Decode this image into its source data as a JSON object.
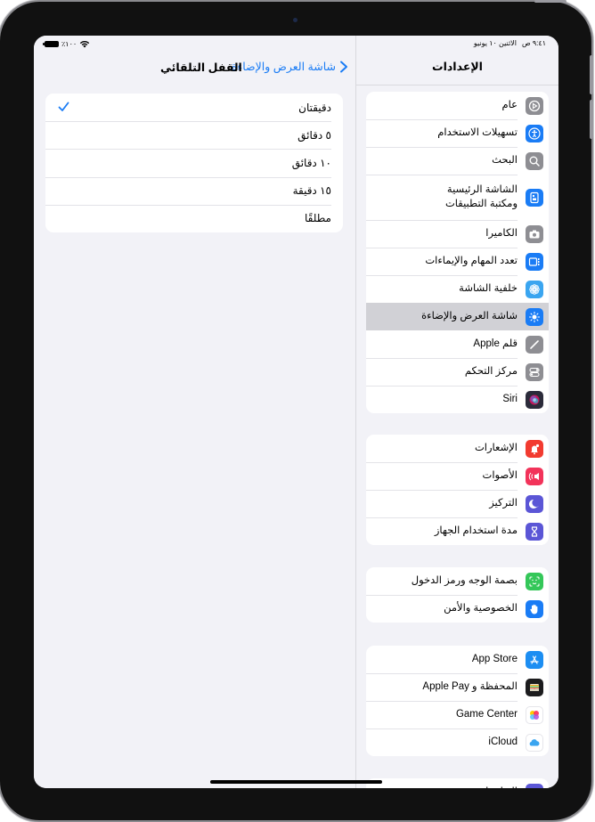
{
  "status_bar": {
    "time": "٩:٤١ ص",
    "date": "الاثنين ١٠ يونيو",
    "battery": "٪١٠٠"
  },
  "sidebar": {
    "title": "الإعدادات",
    "groups": [
      {
        "items": [
          {
            "label": "عام",
            "icon": "gear-icon",
            "color": "#8e8e93"
          },
          {
            "label": "تسهيلات الاستخدام",
            "icon": "accessibility-icon",
            "color": "#1a7cf5"
          },
          {
            "label": "البحث",
            "icon": "search-icon",
            "color": "#8e8e93"
          },
          {
            "label": "الشاشة الرئيسية ومكتبة التطبيقات",
            "line1": "الشاشة الرئيسية",
            "line2": "ومكتبة التطبيقات",
            "icon": "home-screen-icon",
            "color": "#1a7cf5"
          },
          {
            "label": "الكاميرا",
            "icon": "camera-icon",
            "color": "#8e8e93"
          },
          {
            "label": "تعدد المهام والإيماءات",
            "icon": "multitasking-icon",
            "color": "#1a7cf5"
          },
          {
            "label": "خلفية الشاشة",
            "icon": "wallpaper-icon",
            "color": "#3aa5f0"
          },
          {
            "label": "شاشة العرض والإضاءة",
            "icon": "brightness-icon",
            "color": "#1a7cf5",
            "selected": true
          },
          {
            "label": "قلم Apple",
            "icon": "pencil-icon",
            "color": "#8e8e93"
          },
          {
            "label": "مركز التحكم",
            "icon": "control-center-icon",
            "color": "#8e8e93"
          },
          {
            "label": "Siri",
            "icon": "siri-icon",
            "color": "#2b2b3a"
          }
        ]
      },
      {
        "items": [
          {
            "label": "الإشعارات",
            "icon": "notifications-icon",
            "color": "#f23b30"
          },
          {
            "label": "الأصوات",
            "icon": "sounds-icon",
            "color": "#f2335a"
          },
          {
            "label": "التركيز",
            "icon": "focus-moon-icon",
            "color": "#5b56d6"
          },
          {
            "label": "مدة استخدام الجهاز",
            "icon": "screen-time-icon",
            "color": "#5b56d6"
          }
        ]
      },
      {
        "items": [
          {
            "label": "بصمة الوجه ورمز الدخول",
            "icon": "face-id-icon",
            "color": "#34c759"
          },
          {
            "label": "الخصوصية والأمن",
            "icon": "privacy-hand-icon",
            "color": "#1a7cf5"
          }
        ]
      },
      {
        "items": [
          {
            "label": "App Store",
            "icon": "app-store-icon",
            "color": "#1c8ef2"
          },
          {
            "label": "المحفظة و Apple Pay",
            "icon": "wallet-icon",
            "color": "#1c1c1e"
          },
          {
            "label": "Game Center",
            "icon": "game-center-icon",
            "color": "#ffffff"
          },
          {
            "label": "iCloud",
            "icon": "icloud-icon",
            "color": "#ffffff"
          }
        ]
      },
      {
        "items": [
          {
            "label": "التطبيقات",
            "icon": "apps-icon",
            "color": "#5b56d6"
          }
        ]
      }
    ]
  },
  "detail": {
    "back_label": "شاشة العرض والإضاءة",
    "title": "القفل التلقائي",
    "options": [
      {
        "label": "دقيقتان",
        "checked": true
      },
      {
        "label": "٥ دقائق",
        "checked": false
      },
      {
        "label": "١٠ دقائق",
        "checked": false
      },
      {
        "label": "١٥ دقيقة",
        "checked": false
      },
      {
        "label": "مطلقًا",
        "checked": false
      }
    ]
  },
  "colors": {
    "accent": "#1a7cf5",
    "background": "#f2f2f7",
    "selected_row": "#d1d1d6"
  }
}
